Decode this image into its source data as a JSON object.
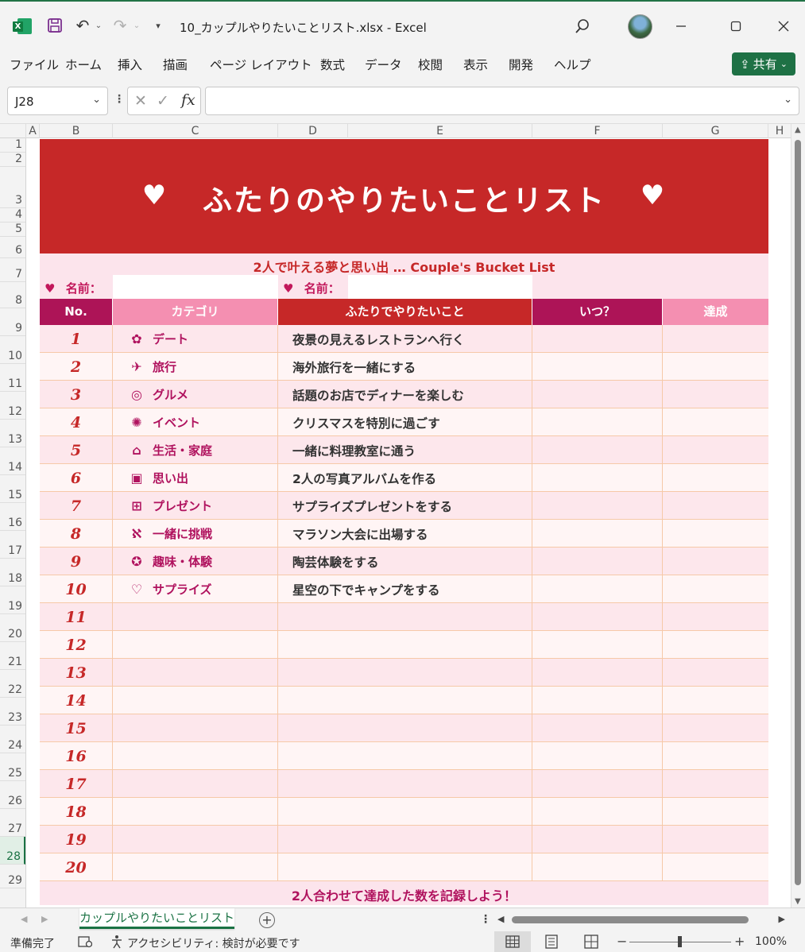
{
  "window": {
    "title": "10_カップルやりたいことリスト.xlsx  -  Excel",
    "app_logo": "X",
    "icons": {
      "save": "save-icon",
      "undo": "undo-icon",
      "redo": "redo-icon",
      "search": "search-icon",
      "minimize": "minimize-icon",
      "maximize": "maximize-icon",
      "close": "close-icon"
    }
  },
  "ribbon": {
    "tabs": [
      "ファイル",
      "ホーム",
      "挿入",
      "描画",
      "ページ レイアウト",
      "数式",
      "データ",
      "校閲",
      "表示",
      "開発",
      "ヘルプ"
    ],
    "share_label": "共有"
  },
  "formula_bar": {
    "cell_ref": "J28",
    "formula_value": ""
  },
  "grid": {
    "columns": [
      "A",
      "B",
      "C",
      "D",
      "E",
      "F",
      "G",
      "H"
    ],
    "rows": [
      "1",
      "2",
      "3",
      "4",
      "5",
      "6",
      "7",
      "8",
      "9",
      "10",
      "11",
      "12",
      "13",
      "14",
      "15",
      "16",
      "17",
      "18",
      "19",
      "20",
      "21",
      "22",
      "23",
      "24",
      "25",
      "26",
      "27",
      "28",
      "29"
    ],
    "active_row": "28"
  },
  "sheet": {
    "title": "ふたりのやりたいことリスト",
    "heart": "♥",
    "subtitle": "2人で叶える夢と思い出 … Couple's Bucket List",
    "name_label": "名前：",
    "headers": [
      "No.",
      "カテゴリ",
      "ふたりでやりたいこと",
      "いつ？",
      "達成"
    ],
    "header_colors": [
      "#ad1457",
      "#f48fb1",
      "#c62828",
      "#ad1457",
      "#f48fb1"
    ],
    "rows": [
      {
        "no": "1",
        "icon": "flower-icon",
        "category": "デート",
        "todo": "夜景の見えるレストランへ行く"
      },
      {
        "no": "2",
        "icon": "airplane-icon",
        "category": "旅行",
        "todo": "海外旅行を一緒にする"
      },
      {
        "no": "3",
        "icon": "plate-icon",
        "category": "グルメ",
        "todo": "話題のお店でディナーを楽しむ"
      },
      {
        "no": "4",
        "icon": "party-icon",
        "category": "イベント",
        "todo": "クリスマスを特別に過ごす"
      },
      {
        "no": "5",
        "icon": "home-icon",
        "category": "生活・家庭",
        "todo": "一緒に料理教室に通う"
      },
      {
        "no": "6",
        "icon": "camera-icon",
        "category": "思い出",
        "todo": "2人の写真アルバムを作る"
      },
      {
        "no": "7",
        "icon": "gift-icon",
        "category": "プレゼント",
        "todo": "サプライズプレゼントをする"
      },
      {
        "no": "8",
        "icon": "runner-icon",
        "category": "一緒に挑戦",
        "todo": "マラソン大会に出場する"
      },
      {
        "no": "9",
        "icon": "palette-icon",
        "category": "趣味・体験",
        "todo": "陶芸体験をする"
      },
      {
        "no": "10",
        "icon": "heart-beat-icon",
        "category": "サプライズ",
        "todo": "星空の下でキャンプをする"
      },
      {
        "no": "11",
        "icon": "",
        "category": "",
        "todo": ""
      },
      {
        "no": "12",
        "icon": "",
        "category": "",
        "todo": ""
      },
      {
        "no": "13",
        "icon": "",
        "category": "",
        "todo": ""
      },
      {
        "no": "14",
        "icon": "",
        "category": "",
        "todo": ""
      },
      {
        "no": "15",
        "icon": "",
        "category": "",
        "todo": ""
      },
      {
        "no": "16",
        "icon": "",
        "category": "",
        "todo": ""
      },
      {
        "no": "17",
        "icon": "",
        "category": "",
        "todo": ""
      },
      {
        "no": "18",
        "icon": "",
        "category": "",
        "todo": ""
      },
      {
        "no": "19",
        "icon": "",
        "category": "",
        "todo": ""
      },
      {
        "no": "20",
        "icon": "",
        "category": "",
        "todo": ""
      }
    ],
    "footer": "2人合わせて達成した数を記録しよう！",
    "colors": {
      "banner": "#c62828",
      "band": "#fce4ec",
      "row_even": "#fde7ec",
      "row_odd": "#fff5f5",
      "accent": "#b0125e"
    }
  },
  "sheet_tabs": {
    "active": "カップルやりたいことリスト"
  },
  "status": {
    "ready": "準備完了",
    "accessibility": "アクセシビリティ: 検討が必要です",
    "zoom": "100%"
  }
}
